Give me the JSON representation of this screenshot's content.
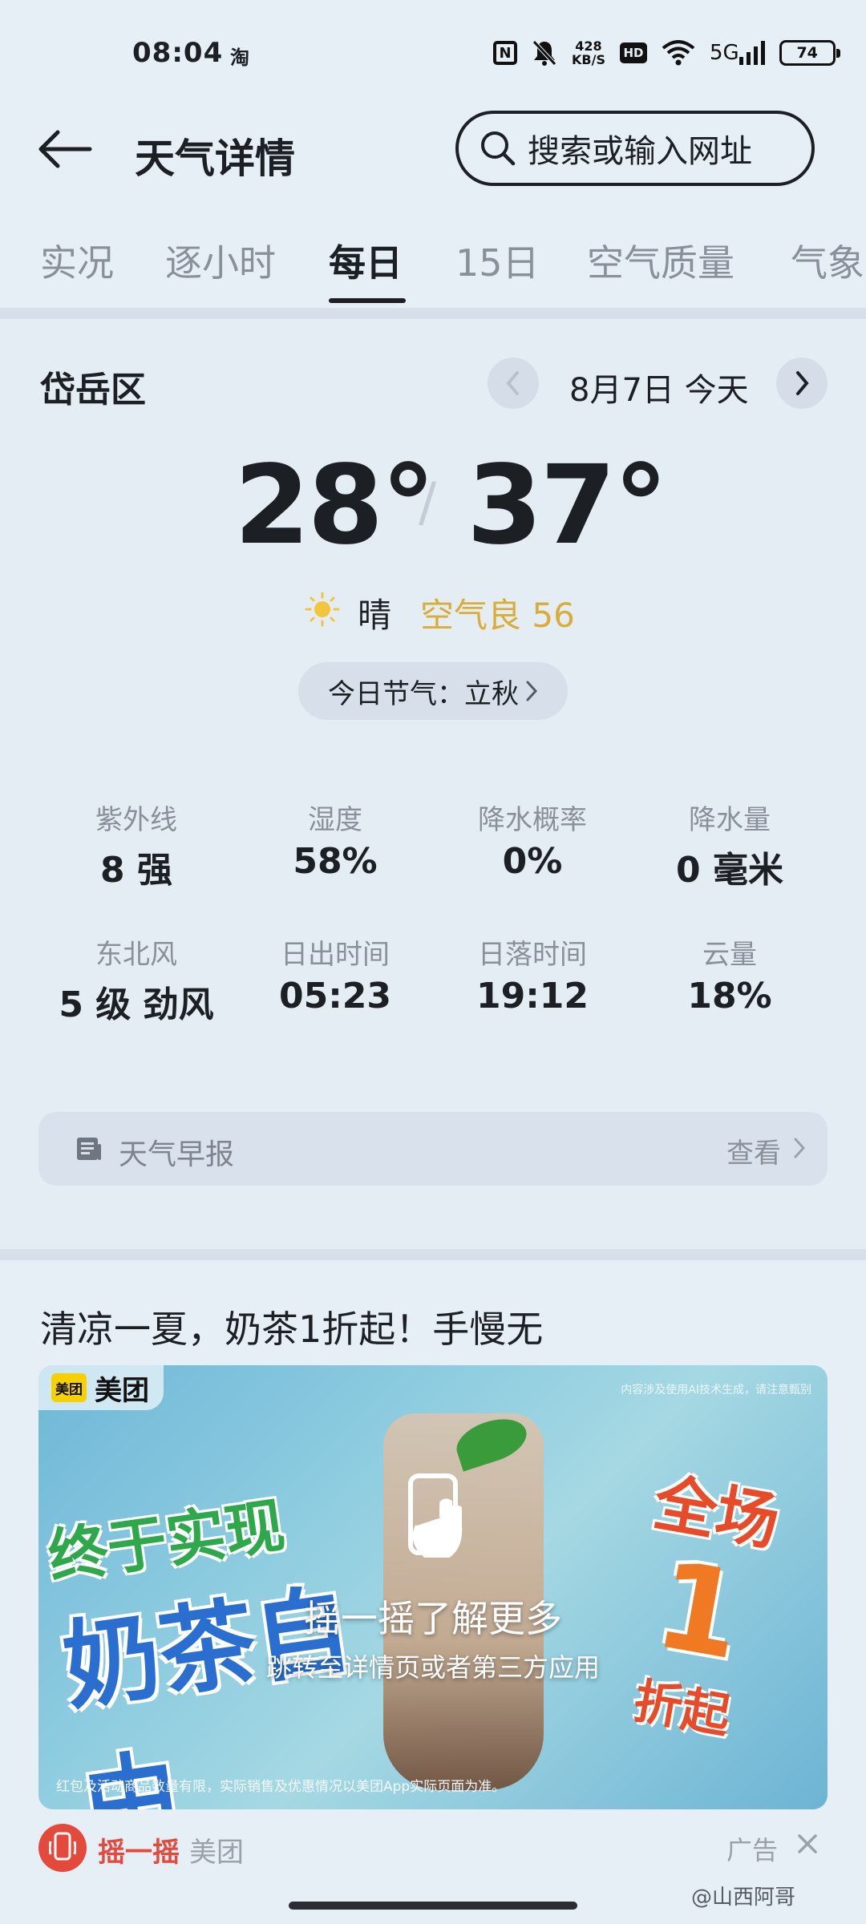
{
  "status_bar": {
    "time": "08:04",
    "app_icon_text": "淘",
    "nfc": "N",
    "net_speed_value": "428",
    "net_speed_unit": "KB/S",
    "hd": "HD",
    "network": "5G",
    "battery": "74"
  },
  "header": {
    "title": "天气详情",
    "search_placeholder": "搜索或输入网址"
  },
  "tabs": [
    {
      "label": "实况"
    },
    {
      "label": "逐小时"
    },
    {
      "label": "每日",
      "active": true
    },
    {
      "label": "15日"
    },
    {
      "label": "空气质量"
    },
    {
      "label": "气象"
    }
  ],
  "daily": {
    "location": "岱岳区",
    "date": "8月7日 今天",
    "temp_low": "28°",
    "temp_high": "37°",
    "condition": "晴",
    "air_quality": "空气良 56",
    "solar_term": "今日节气：立秋",
    "metrics": [
      {
        "label": "紫外线",
        "value": "8 强"
      },
      {
        "label": "湿度",
        "value": "58%"
      },
      {
        "label": "降水概率",
        "value": "0%"
      },
      {
        "label": "降水量",
        "value": "0 毫米"
      },
      {
        "label": "东北风",
        "value": "5 级 劲风"
      },
      {
        "label": "日出时间",
        "value": "05:23"
      },
      {
        "label": "日落时间",
        "value": "19:12"
      },
      {
        "label": "云量",
        "value": "18%"
      }
    ],
    "report_label": "天气早报",
    "report_action": "查看"
  },
  "ad": {
    "title": "清凉一夏，奶茶1折起！手慢无",
    "brand_logo": "美团",
    "brand_name": "美团",
    "ai_note": "内容涉及使用AI技术生成，请注意甄别",
    "slogan_left_1": "终于实现",
    "slogan_left_2": "奶茶自由",
    "slogan_right_1": "全场",
    "slogan_right_2": "1",
    "slogan_right_3": "折起",
    "shake_text": "摇一摇了解更多",
    "shake_sub": "跳转至详情页或者第三方应用",
    "disclaimer": "红包及活动商品数量有限，实际销售及优惠情况以美团App实际页面为准。",
    "footer_action": "摇一摇",
    "footer_source": "美团",
    "footer_label": "广告"
  },
  "watermark": "@山西阿哥",
  "colors": {
    "background": "#e6eef6",
    "accent_air": "#d9ad38",
    "shake_red": "#e34a3c"
  }
}
